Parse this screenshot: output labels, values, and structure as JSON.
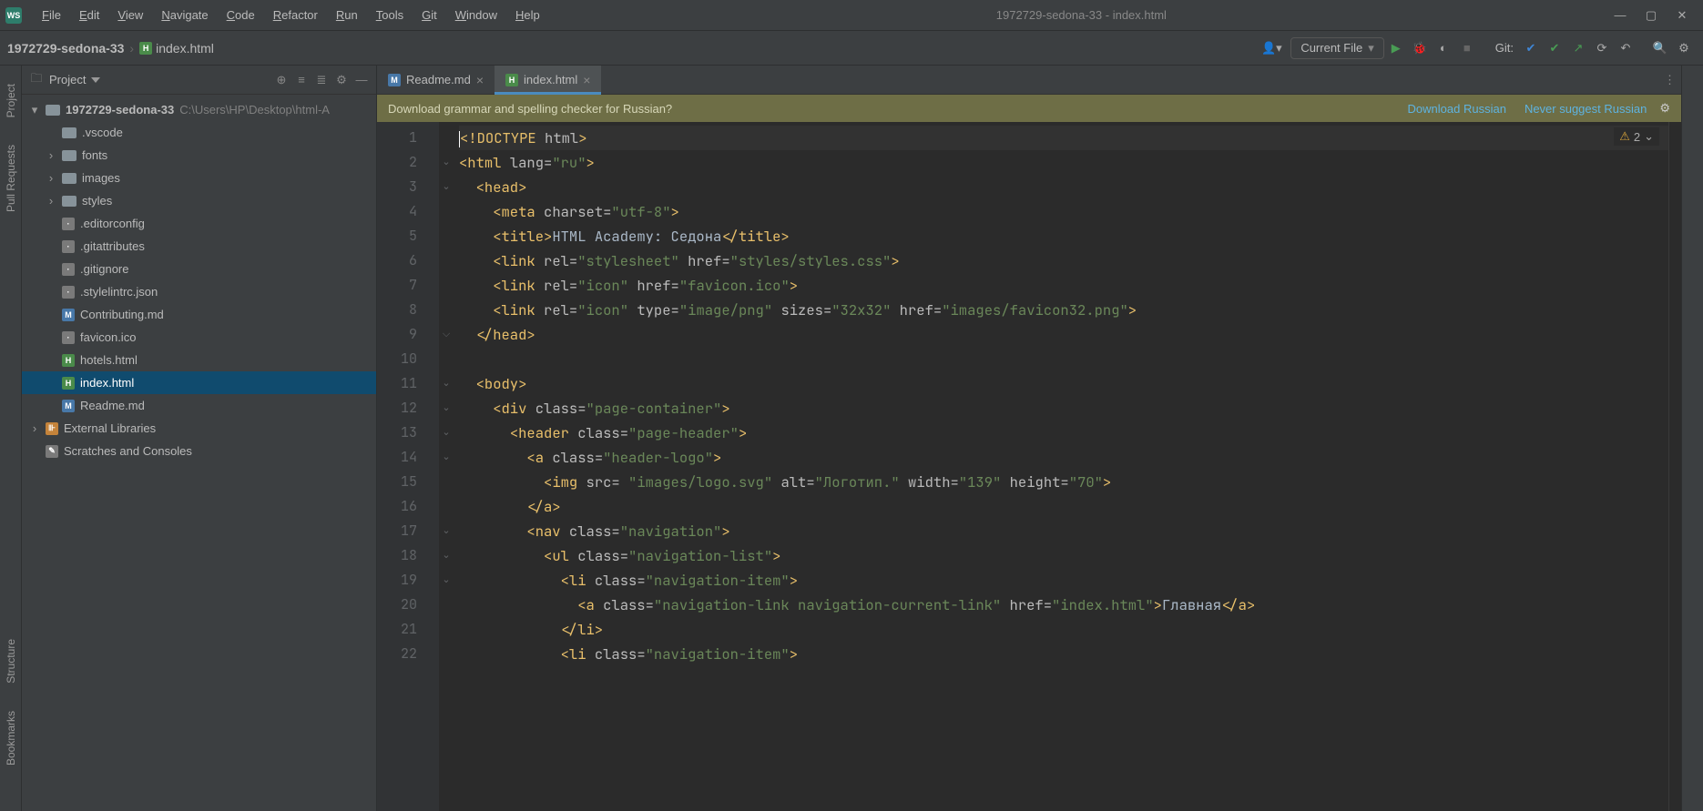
{
  "window": {
    "title": "1972729-sedona-33 - index.html",
    "app_icon_label": "WS"
  },
  "menu": [
    "File",
    "Edit",
    "View",
    "Navigate",
    "Code",
    "Refactor",
    "Run",
    "Tools",
    "Git",
    "Window",
    "Help"
  ],
  "breadcrumb": {
    "project": "1972729-sedona-33",
    "file": "index.html"
  },
  "toolbar": {
    "run_config": "Current File",
    "git_label": "Git:"
  },
  "side_rail": [
    "Project",
    "Pull Requests",
    "Structure",
    "Bookmarks"
  ],
  "project_panel": {
    "title": "Project",
    "root": {
      "name": "1972729-sedona-33",
      "path": "C:\\Users\\HP\\Desktop\\html-A"
    },
    "folders": [
      {
        "name": ".vscode",
        "expandable": false
      },
      {
        "name": "fonts",
        "expandable": true
      },
      {
        "name": "images",
        "expandable": true
      },
      {
        "name": "styles",
        "expandable": true
      }
    ],
    "files": [
      {
        "name": ".editorconfig",
        "icon": "gen"
      },
      {
        "name": ".gitattributes",
        "icon": "gen"
      },
      {
        "name": ".gitignore",
        "icon": "gen"
      },
      {
        "name": ".stylelintrc.json",
        "icon": "gen"
      },
      {
        "name": "Contributing.md",
        "icon": "md"
      },
      {
        "name": "favicon.ico",
        "icon": "gen"
      },
      {
        "name": "hotels.html",
        "icon": "html"
      },
      {
        "name": "index.html",
        "icon": "html",
        "selected": true
      },
      {
        "name": "Readme.md",
        "icon": "md"
      }
    ],
    "extras": [
      "External Libraries",
      "Scratches and Consoles"
    ]
  },
  "tabs": [
    {
      "label": "Readme.md",
      "icon": "md",
      "active": false
    },
    {
      "label": "index.html",
      "icon": "html",
      "active": true
    }
  ],
  "banner": {
    "prompt": "Download grammar and spelling checker for Russian?",
    "link1": "Download Russian",
    "link2": "Never suggest Russian"
  },
  "inspections": {
    "warnings": "2"
  },
  "code_lines": [
    {
      "n": 1,
      "cur": true,
      "tokens": [
        [
          "tag",
          "<!DOCTYPE "
        ],
        [
          "attr",
          "html"
        ],
        [
          "tag",
          ">"
        ]
      ]
    },
    {
      "n": 2,
      "tokens": [
        [
          "tag",
          "<html "
        ],
        [
          "attr",
          "lang="
        ],
        [
          "str",
          "\"ru\""
        ],
        [
          "tag",
          ">"
        ]
      ]
    },
    {
      "n": 3,
      "tokens": [
        [
          "txt",
          "  "
        ],
        [
          "tag",
          "<head>"
        ]
      ]
    },
    {
      "n": 4,
      "tokens": [
        [
          "txt",
          "    "
        ],
        [
          "tag",
          "<meta "
        ],
        [
          "attr",
          "charset="
        ],
        [
          "str",
          "\"utf-8\""
        ],
        [
          "tag",
          ">"
        ]
      ]
    },
    {
      "n": 5,
      "tokens": [
        [
          "txt",
          "    "
        ],
        [
          "tag",
          "<title>"
        ],
        [
          "txt",
          "HTML Academy: Седона"
        ],
        [
          "tag",
          "</title>"
        ]
      ]
    },
    {
      "n": 6,
      "tokens": [
        [
          "txt",
          "    "
        ],
        [
          "tag",
          "<link "
        ],
        [
          "attr",
          "rel="
        ],
        [
          "str",
          "\"stylesheet\""
        ],
        [
          "attr",
          " href="
        ],
        [
          "str",
          "\"styles/styles.css\""
        ],
        [
          "tag",
          ">"
        ]
      ]
    },
    {
      "n": 7,
      "tokens": [
        [
          "txt",
          "    "
        ],
        [
          "tag",
          "<link "
        ],
        [
          "attr",
          "rel="
        ],
        [
          "str",
          "\"icon\""
        ],
        [
          "attr",
          " href="
        ],
        [
          "str",
          "\"favicon.ico\""
        ],
        [
          "tag",
          ">"
        ]
      ]
    },
    {
      "n": 8,
      "tokens": [
        [
          "txt",
          "    "
        ],
        [
          "tag",
          "<link "
        ],
        [
          "attr",
          "rel="
        ],
        [
          "str",
          "\"icon\""
        ],
        [
          "attr",
          " type="
        ],
        [
          "str",
          "\"image/png\""
        ],
        [
          "attr",
          " sizes="
        ],
        [
          "str",
          "\"32x32\""
        ],
        [
          "attr",
          " href="
        ],
        [
          "str",
          "\"images/favicon32.png\""
        ],
        [
          "tag",
          ">"
        ]
      ]
    },
    {
      "n": 9,
      "tokens": [
        [
          "txt",
          "  "
        ],
        [
          "tag",
          "</head>"
        ]
      ]
    },
    {
      "n": 10,
      "tokens": []
    },
    {
      "n": 11,
      "tokens": [
        [
          "txt",
          "  "
        ],
        [
          "tag",
          "<body>"
        ]
      ]
    },
    {
      "n": 12,
      "tokens": [
        [
          "txt",
          "    "
        ],
        [
          "tag",
          "<div "
        ],
        [
          "attr",
          "class="
        ],
        [
          "str",
          "\"page-container\""
        ],
        [
          "tag",
          ">"
        ]
      ]
    },
    {
      "n": 13,
      "tokens": [
        [
          "txt",
          "      "
        ],
        [
          "tag",
          "<header "
        ],
        [
          "attr",
          "class="
        ],
        [
          "str",
          "\"page-header\""
        ],
        [
          "tag",
          ">"
        ]
      ]
    },
    {
      "n": 14,
      "tokens": [
        [
          "txt",
          "        "
        ],
        [
          "tag",
          "<a "
        ],
        [
          "attr",
          "class="
        ],
        [
          "str",
          "\"header-logo\""
        ],
        [
          "tag",
          ">"
        ]
      ]
    },
    {
      "n": 15,
      "tokens": [
        [
          "txt",
          "          "
        ],
        [
          "tag",
          "<img "
        ],
        [
          "attr",
          "src= "
        ],
        [
          "str",
          "\"images/logo.svg\""
        ],
        [
          "attr",
          " alt="
        ],
        [
          "str",
          "\"Логотип.\""
        ],
        [
          "attr",
          " width="
        ],
        [
          "str",
          "\"139\""
        ],
        [
          "attr",
          " height="
        ],
        [
          "str",
          "\"70\""
        ],
        [
          "tag",
          ">"
        ]
      ]
    },
    {
      "n": 16,
      "tokens": [
        [
          "txt",
          "        "
        ],
        [
          "tag",
          "</a>"
        ]
      ]
    },
    {
      "n": 17,
      "tokens": [
        [
          "txt",
          "        "
        ],
        [
          "tag",
          "<nav "
        ],
        [
          "attr",
          "class="
        ],
        [
          "str",
          "\"navigation\""
        ],
        [
          "tag",
          ">"
        ]
      ]
    },
    {
      "n": 18,
      "tokens": [
        [
          "txt",
          "          "
        ],
        [
          "tag",
          "<ul "
        ],
        [
          "attr",
          "class="
        ],
        [
          "str",
          "\"navigation-list\""
        ],
        [
          "tag",
          ">"
        ]
      ]
    },
    {
      "n": 19,
      "tokens": [
        [
          "txt",
          "            "
        ],
        [
          "tag",
          "<li "
        ],
        [
          "attr",
          "class="
        ],
        [
          "str",
          "\"navigation-item\""
        ],
        [
          "tag",
          ">"
        ]
      ]
    },
    {
      "n": 20,
      "tokens": [
        [
          "txt",
          "              "
        ],
        [
          "tag",
          "<a "
        ],
        [
          "attr",
          "class="
        ],
        [
          "str",
          "\"navigation-link navigation-current-link\""
        ],
        [
          "attr",
          " href="
        ],
        [
          "str",
          "\"index.html\""
        ],
        [
          "tag",
          ">"
        ],
        [
          "txt",
          "Главная"
        ],
        [
          "tag",
          "</a>"
        ]
      ]
    },
    {
      "n": 21,
      "tokens": [
        [
          "txt",
          "            "
        ],
        [
          "tag",
          "</li>"
        ]
      ]
    },
    {
      "n": 22,
      "tokens": [
        [
          "txt",
          "            "
        ],
        [
          "tag",
          "<li "
        ],
        [
          "attr",
          "class="
        ],
        [
          "str",
          "\"navigation-item\""
        ],
        [
          "tag",
          ">"
        ]
      ]
    }
  ]
}
